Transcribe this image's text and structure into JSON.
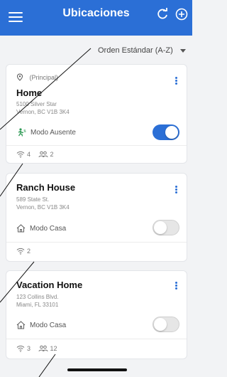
{
  "header": {
    "title": "Ubicaciones",
    "bg_color": "#2b6fd6"
  },
  "sort": {
    "label": "Orden Estándar (A-Z)"
  },
  "locations": [
    {
      "badge": "(Principal)",
      "name": "Home",
      "address_line1": "5100 Silver Star",
      "address_line2": "Vernon, BC V1B 3K4",
      "mode": "Modo Ausente",
      "mode_icon": "away-person-icon",
      "toggle_on": true,
      "wifi_count": "4",
      "users_count": "2"
    },
    {
      "name": "Ranch House",
      "address_line1": "589 State St.",
      "address_line2": "Vernon, BC V1B 3K4",
      "mode": "Modo Casa",
      "mode_icon": "house-icon",
      "toggle_on": false,
      "wifi_count": "2"
    },
    {
      "name": "Vacation Home",
      "address_line1": "123 Collins Blvd.",
      "address_line2": "Miami, FL 33101",
      "mode": "Modo Casa",
      "mode_icon": "house-icon",
      "toggle_on": false,
      "wifi_count": "3",
      "users_count": "12"
    }
  ]
}
